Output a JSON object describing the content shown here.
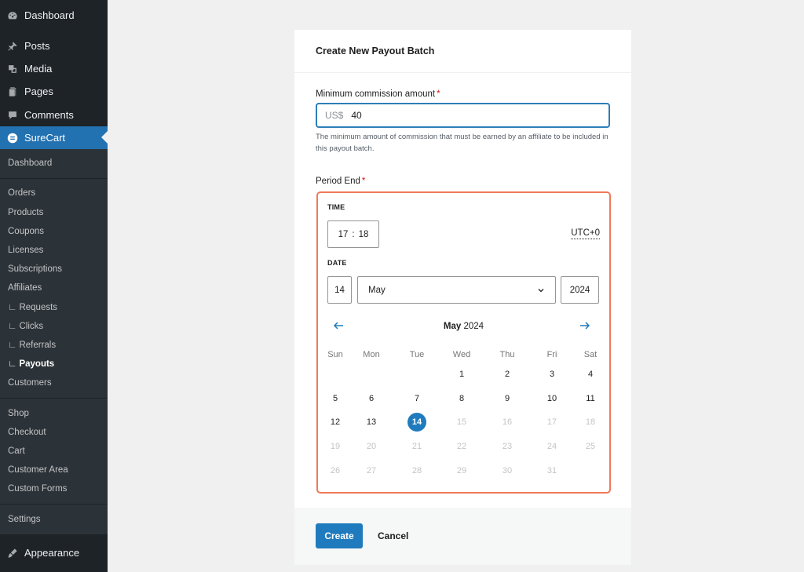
{
  "sidebar": {
    "top_items": [
      {
        "label": "Dashboard",
        "icon": "dashboard-icon"
      },
      {
        "label": "Posts",
        "icon": "pin-icon"
      },
      {
        "label": "Media",
        "icon": "media-icon"
      },
      {
        "label": "Pages",
        "icon": "pages-icon"
      },
      {
        "label": "Comments",
        "icon": "comment-icon"
      },
      {
        "label": "SureCart",
        "icon": "surecart-icon"
      }
    ],
    "sub_items": [
      "Dashboard",
      "Orders",
      "Products",
      "Coupons",
      "Licenses",
      "Subscriptions",
      "Affiliates",
      "∟ Requests",
      "∟ Clicks",
      "∟ Referrals",
      "∟ Payouts",
      "Customers",
      "Shop",
      "Checkout",
      "Cart",
      "Customer Area",
      "Custom Forms",
      "Settings"
    ],
    "appearance": {
      "label": "Appearance",
      "icon": "paintbrush-icon"
    }
  },
  "form": {
    "title": "Create New Payout Batch",
    "amount_label": "Minimum commission amount",
    "required_mark": "*",
    "amount_prefix": "US$",
    "amount_value": "40",
    "amount_help": "The minimum amount of commission that must be earned by an affiliate to be included in this payout batch.",
    "period_label": "Period End",
    "time_label": "TIME",
    "hour": "17",
    "minute": "18",
    "time_sep": ":",
    "timezone": "UTC+0",
    "date_label": "DATE",
    "day": "14",
    "month": "May",
    "year": "2024",
    "calendar_month": "May",
    "calendar_year": "2024",
    "weekdays": [
      "Sun",
      "Mon",
      "Tue",
      "Wed",
      "Thu",
      "Fri",
      "Sat"
    ],
    "create_label": "Create",
    "cancel_label": "Cancel"
  },
  "calendar": {
    "first_weekday_index": 3,
    "days_in_month": 31,
    "selected_day": 14,
    "enabled_through": 14
  },
  "colors": {
    "accent": "#1f7bbd",
    "sidebar_bg": "#1d2327",
    "focus_ring": "#f0795a"
  }
}
